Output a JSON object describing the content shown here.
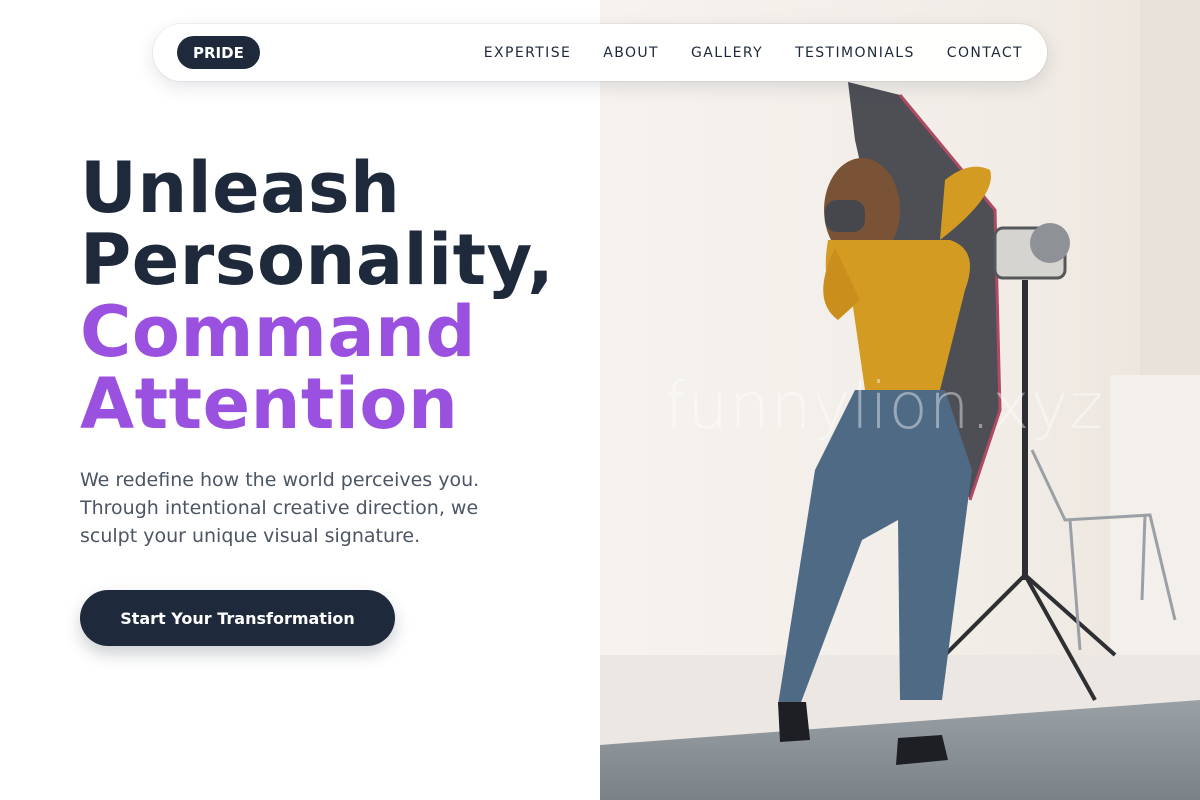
{
  "nav": {
    "logo": "PRIDE",
    "links": [
      "EXPERTISE",
      "ABOUT",
      "GALLERY",
      "TESTIMONIALS",
      "CONTACT"
    ]
  },
  "hero": {
    "line1": "Unleash",
    "line2": "Personality,",
    "line3": "Command",
    "line4": "Attention",
    "lead": "We redefine how the world perceives you. Through intentional creative direction, we sculpt your unique visual signature.",
    "cta": "Start Your Transformation"
  },
  "watermark": "funnylion.xyz",
  "colors": {
    "dark": "#1e293b",
    "accent": "#9b51e0",
    "body_text": "#4b5563"
  }
}
